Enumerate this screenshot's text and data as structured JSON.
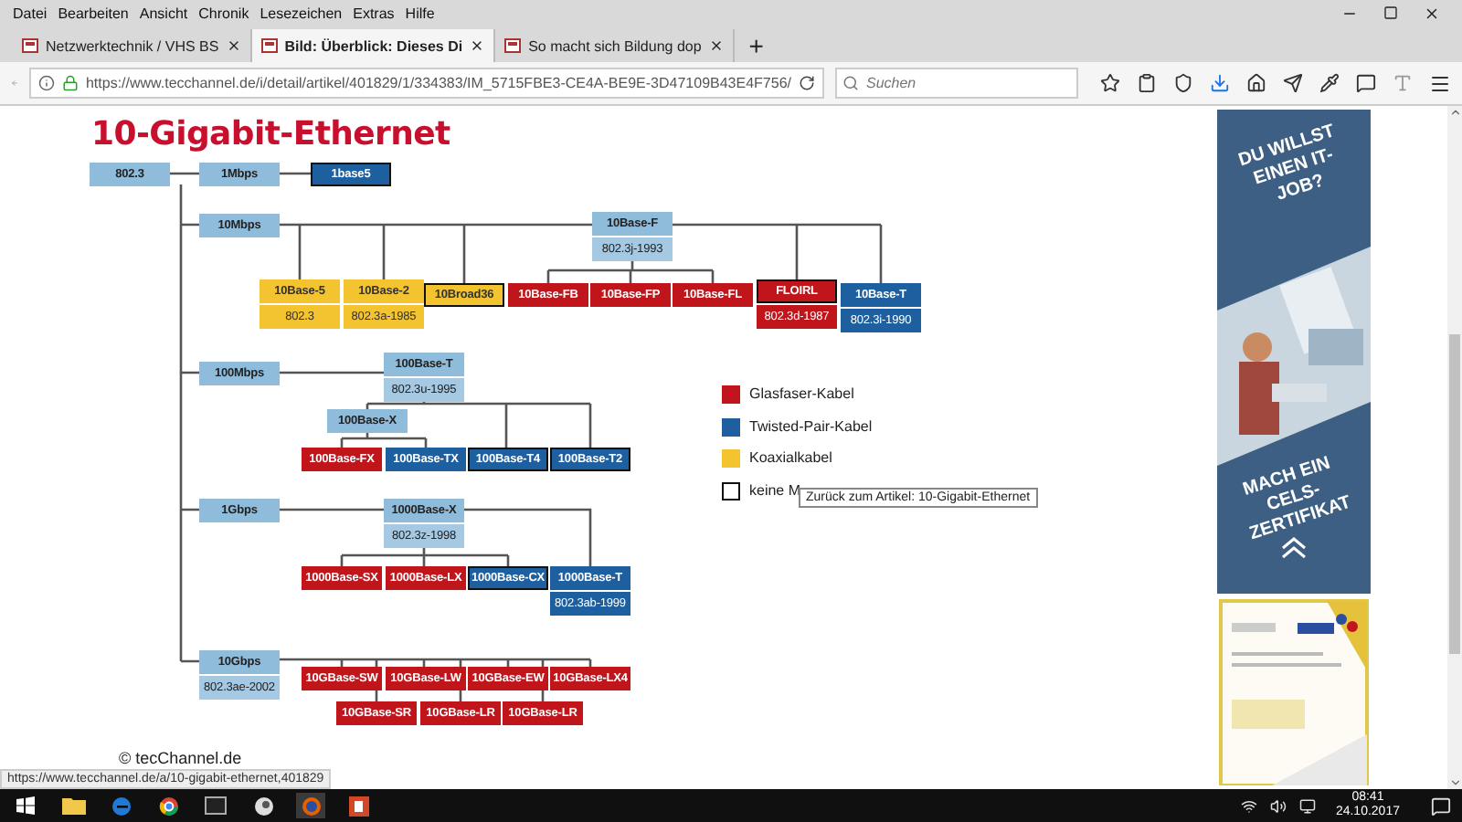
{
  "menu": [
    "Datei",
    "Bearbeiten",
    "Ansicht",
    "Chronik",
    "Lesezeichen",
    "Extras",
    "Hilfe"
  ],
  "tabs": [
    {
      "title": "Netzwerktechnik / VHS BS",
      "selected": false
    },
    {
      "title": "Bild: Überblick: Dieses Di",
      "selected": true
    },
    {
      "title": "So macht sich Bildung dop",
      "selected": false
    }
  ],
  "new_tab": "+",
  "address": {
    "url": "https://www.tecchannel.de/i/detail/artikel/401829/1/334383/IM_5715FBE3-CE4A-BE9E-3D47109B43E4F756/"
  },
  "search": {
    "placeholder": "Suchen"
  },
  "article": {
    "title": "10-Gigabit-Ethernet",
    "credit": "© tecChannel.de"
  },
  "diagram": {
    "nodes": [
      {
        "label": "802.3",
        "kind": "speed",
        "outlined": false
      },
      {
        "label": "1Mbps",
        "kind": "speed",
        "outlined": false
      },
      {
        "label": "1base5",
        "kind": "twisted",
        "outlined": true
      },
      {
        "label": "10Mbps",
        "kind": "speed",
        "outlined": false
      },
      {
        "label": "10Base-F",
        "standard": "802.3j-1993",
        "kind": "speed",
        "outlined": false
      },
      {
        "label": "10Base-5",
        "standard": "802.3",
        "kind": "coax",
        "outlined": false
      },
      {
        "label": "10Base-2",
        "standard": "802.3a-1985",
        "kind": "coax",
        "outlined": false
      },
      {
        "label": "10Broad36",
        "kind": "coax",
        "outlined": true
      },
      {
        "label": "10Base-FB",
        "kind": "fiber",
        "outlined": false
      },
      {
        "label": "10Base-FP",
        "kind": "fiber",
        "outlined": false
      },
      {
        "label": "10Base-FL",
        "kind": "fiber",
        "outlined": false
      },
      {
        "label": "FLOIRL",
        "standard": "802.3d-1987",
        "kind": "fiber",
        "outlined": true
      },
      {
        "label": "10Base-T",
        "standard": "802.3i-1990",
        "kind": "twisted",
        "outlined": false
      },
      {
        "label": "100Mbps",
        "kind": "speed",
        "outlined": false
      },
      {
        "label": "100Base-T",
        "standard": "802.3u-1995",
        "kind": "speed",
        "outlined": false
      },
      {
        "label": "100Base-X",
        "kind": "speed",
        "outlined": false
      },
      {
        "label": "100Base-FX",
        "kind": "fiber",
        "outlined": false
      },
      {
        "label": "100Base-TX",
        "kind": "twisted",
        "outlined": false
      },
      {
        "label": "100Base-T4",
        "kind": "twisted",
        "outlined": true
      },
      {
        "label": "100Base-T2",
        "kind": "twisted",
        "outlined": true
      },
      {
        "label": "1Gbps",
        "kind": "speed",
        "outlined": false
      },
      {
        "label": "1000Base-X",
        "standard": "802.3z-1998",
        "kind": "speed",
        "outlined": false
      },
      {
        "label": "1000Base-SX",
        "kind": "fiber",
        "outlined": false
      },
      {
        "label": "1000Base-LX",
        "kind": "fiber",
        "outlined": false
      },
      {
        "label": "1000Base-CX",
        "kind": "twisted",
        "outlined": true
      },
      {
        "label": "1000Base-T",
        "standard": "802.3ab-1999",
        "kind": "twisted",
        "outlined": false
      },
      {
        "label": "10Gbps",
        "standard": "802.3ae-2002",
        "kind": "speed",
        "outlined": false
      },
      {
        "label": "10GBase-SW",
        "kind": "fiber",
        "outlined": false
      },
      {
        "label": "10GBase-LW",
        "kind": "fiber",
        "outlined": false
      },
      {
        "label": "10GBase-EW",
        "kind": "fiber",
        "outlined": false
      },
      {
        "label": "10GBase-LX4",
        "kind": "fiber",
        "outlined": false
      },
      {
        "label": "10GBase-SR",
        "kind": "fiber",
        "outlined": false
      },
      {
        "label": "10GBase-LR",
        "kind": "fiber",
        "outlined": false
      },
      {
        "label": "10GBase-LR",
        "kind": "fiber",
        "outlined": false
      }
    ],
    "legend": [
      {
        "label": "Glasfaser-Kabel",
        "kind": "fiber"
      },
      {
        "label": "Twisted-Pair-Kabel",
        "kind": "twisted"
      },
      {
        "label": "Koaxialkabel",
        "kind": "coax"
      },
      {
        "label": "keine M",
        "kind": "outline"
      }
    ]
  },
  "tooltip": "Zurück zum Artikel: 10-Gigabit-Ethernet",
  "status_url": "https://www.tecchannel.de/a/10-gigabit-ethernet,401829",
  "ad": {
    "headline": "DU WILLST EINEN IT-JOB?",
    "tagline": "MACH EIN CELS-ZERTIFIKAT"
  },
  "taskbar": {
    "time": "08:41",
    "date": "24.10.2017"
  }
}
